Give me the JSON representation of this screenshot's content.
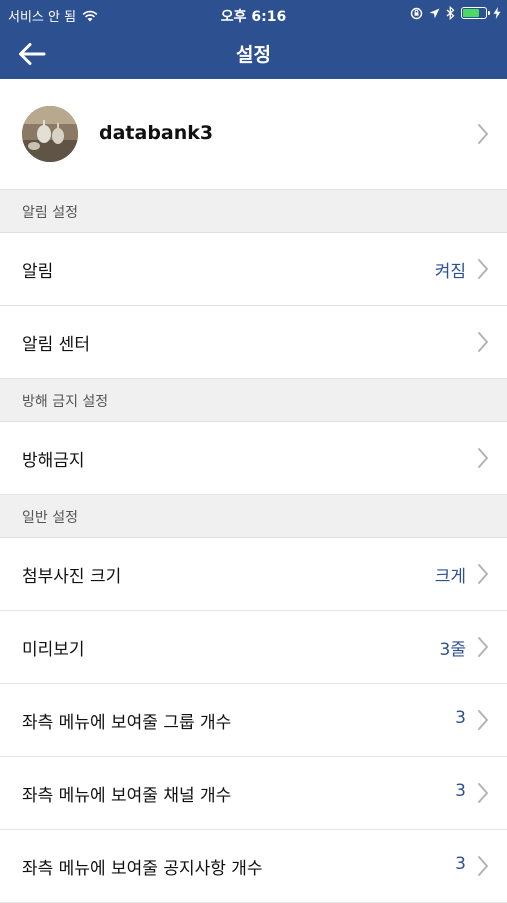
{
  "status_bar": {
    "carrier": "서비스 안 됨",
    "time": "오후 6:16"
  },
  "header": {
    "title": "설정"
  },
  "profile": {
    "username": "databank3"
  },
  "sections": [
    {
      "title": "알림 설정",
      "rows": [
        {
          "label": "알림",
          "value": "켜짐"
        },
        {
          "label": "알림 센터",
          "value": ""
        }
      ]
    },
    {
      "title": "방해 금지 설정",
      "rows": [
        {
          "label": "방해금지",
          "value": ""
        }
      ]
    },
    {
      "title": "일반 설정",
      "rows": [
        {
          "label": "첨부사진 크기",
          "value": "크게"
        },
        {
          "label": "미리보기",
          "value": "3줄"
        },
        {
          "label": "좌측 메뉴에 보여줄 그룹 개수",
          "value": "3"
        },
        {
          "label": "좌측 메뉴에 보여줄 채널 개수",
          "value": "3"
        },
        {
          "label": "좌측 메뉴에 보여줄 공지사항 개수",
          "value": "3"
        }
      ]
    }
  ],
  "colors": {
    "header_bg": "#2d5190",
    "value_text": "#2d5190",
    "battery_fill": "#4cd964"
  }
}
